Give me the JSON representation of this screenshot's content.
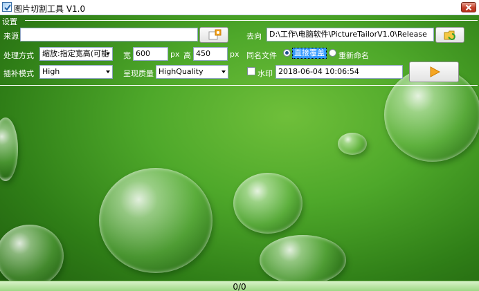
{
  "window": {
    "title": "图片切割工具 V1.0"
  },
  "settings": {
    "group_label": "设置",
    "source_label": "来源",
    "source_value": "",
    "dest_label": "去向",
    "dest_value": "D:\\工作\\电脑软件\\PictureTailorV1.0\\Release",
    "mode_label": "处理方式",
    "mode_value": "缩放:指定宽高(可能",
    "width_label": "宽",
    "width_value": "600",
    "width_unit": "px",
    "height_label": "高",
    "height_value": "450",
    "height_unit": "px",
    "samename_label": "同名文件",
    "overwrite_label": "直接覆盖",
    "rename_label": "重新命名",
    "interp_label": "插补模式",
    "interp_value": "High",
    "quality_label": "呈现质量",
    "quality_value": "HighQuality",
    "watermark_label": "水印",
    "watermark_value": "2018-06-04 10:06:54"
  },
  "status": {
    "text": "0/0"
  },
  "colors": {
    "accent": "#3399ff",
    "run_button": "#f5a623",
    "status_bar": "#9ed985"
  },
  "icons": [
    "app-icon",
    "close-icon",
    "browse-source-icon",
    "browse-dest-icon",
    "run-icon"
  ]
}
